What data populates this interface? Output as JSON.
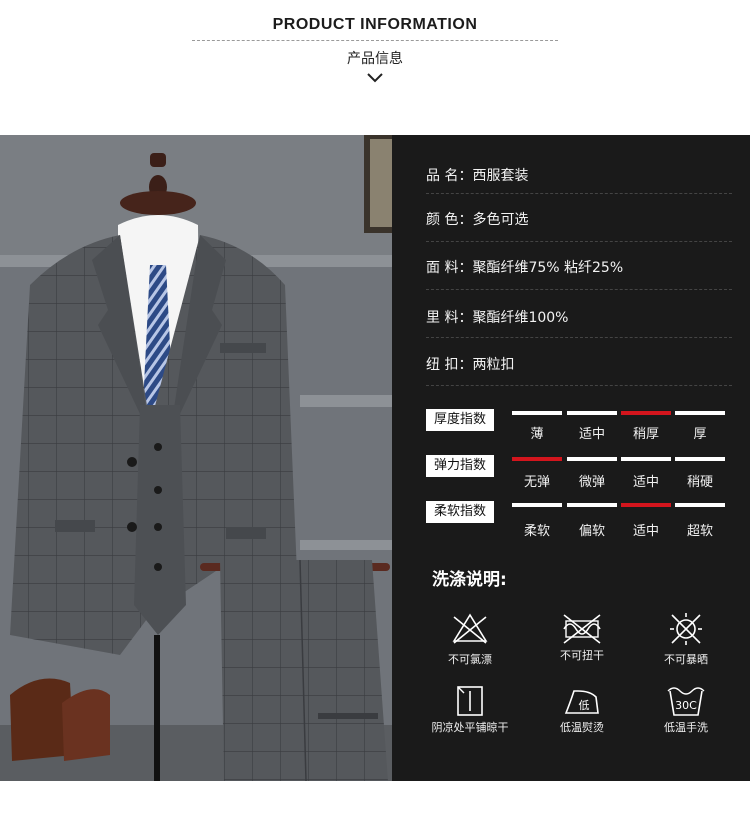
{
  "header": {
    "title": "PRODUCT INFORMATION",
    "subtitle": "产品信息"
  },
  "specs": [
    {
      "label": "品  名：",
      "value": "西服套装"
    },
    {
      "label": "颜  色：",
      "value": "多色可选"
    },
    {
      "label": "面  料：",
      "value": "聚酯纤维75%  粘纤25%"
    },
    {
      "label": "里  料：",
      "value": "聚酯纤维100%"
    },
    {
      "label": "纽  扣：",
      "value": "两粒扣"
    }
  ],
  "indicators": [
    {
      "label": "厚度指数",
      "options": [
        "薄",
        "适中",
        "稍厚",
        "厚"
      ],
      "selected": 2
    },
    {
      "label": "弹力指数",
      "options": [
        "无弹",
        "微弹",
        "适中",
        "稍硬"
      ],
      "selected": 0
    },
    {
      "label": "柔软指数",
      "options": [
        "柔软",
        "偏软",
        "适中",
        "超软"
      ],
      "selected": 2
    }
  ],
  "care": {
    "title": "洗涤说明:",
    "items": [
      {
        "icon": "no-bleach-icon",
        "label": "不可氯漂"
      },
      {
        "icon": "no-wring-icon",
        "label": "不可扭干"
      },
      {
        "icon": "no-sun-dry-icon",
        "label": "不可暴晒"
      },
      {
        "icon": "shade-dry-flat-icon",
        "label": "阴凉处平铺晾干"
      },
      {
        "icon": "low-iron-icon",
        "label": "低温熨烫"
      },
      {
        "icon": "hand-wash-30-icon",
        "label": "低温手洗"
      }
    ],
    "iron_text": "低",
    "wash_temp": "30C"
  },
  "colors": {
    "accent": "#d3151d",
    "panel_bg": "#1a1a1a"
  }
}
